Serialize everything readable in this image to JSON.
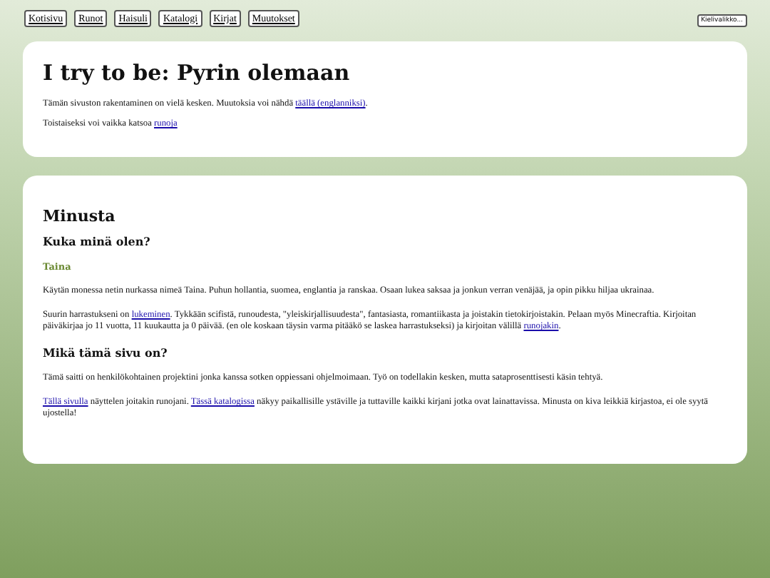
{
  "nav": {
    "links": [
      "Kotisivu",
      "Runot",
      "Haisuli",
      "Katalogi",
      "Kirjat",
      "Muutokset"
    ],
    "language_button": "Kielivalikko..."
  },
  "intro": {
    "title": "I try to be: Pyrin olemaan",
    "paragraphs": [
      [
        {
          "kind": "text",
          "text": "Tämän sivuston rakentaminen on vielä kesken. Muutoksia voi nähdä "
        },
        {
          "kind": "link",
          "text": "täällä (englanniksi)"
        },
        {
          "kind": "text",
          "text": "."
        }
      ],
      [
        {
          "kind": "text",
          "text": "Toistaiseksi voi vaikka katsoa "
        },
        {
          "kind": "link",
          "text": "runoja"
        }
      ]
    ]
  },
  "about": {
    "blocks": [
      {
        "kind": "heading",
        "text": "Minusta"
      },
      {
        "kind": "subheading",
        "text": "Kuka minä olen?"
      },
      {
        "kind": "name",
        "text": "Taina"
      },
      {
        "kind": "paragraph",
        "parts": [
          {
            "kind": "text",
            "text": "Käytän monessa netin nurkassa nimeä Taina. Puhun hollantia, suomea, englantia ja ranskaa. Osaan lukea saksaa ja jonkun verran venäjää, ja opin pikku hiljaa ukrainaa."
          }
        ]
      },
      {
        "kind": "paragraph",
        "parts": [
          {
            "kind": "text",
            "text": "Suurin harrastukseni on "
          },
          {
            "kind": "link",
            "text": "lukeminen"
          },
          {
            "kind": "text",
            "text": ". Tykkään scifistä, runoudesta, \"yleiskirjallisuudesta\", fantasiasta, romantiikasta ja joistakin tietokirjoistakin. Pelaan myös Minecraftia. Kirjoitan päiväkirjaa jo 11 vuotta, 11 kuukautta ja 0 päivää. (en ole koskaan täysin varma pitääkö se laskea harrastukseksi) ja kirjoitan välillä "
          },
          {
            "kind": "link",
            "text": "runojakin"
          },
          {
            "kind": "text",
            "text": "."
          }
        ]
      },
      {
        "kind": "subheading",
        "text": "Mikä tämä sivu on?"
      },
      {
        "kind": "paragraph",
        "parts": [
          {
            "kind": "text",
            "text": "Tämä saitti on henkilökohtainen projektini jonka kanssa sotken oppiessani ohjelmoimaan. Työ on todellakin kesken, mutta sataprosenttisesti käsin tehtyä."
          }
        ]
      },
      {
        "kind": "paragraph",
        "parts": [
          {
            "kind": "link",
            "text": "Tällä sivulla"
          },
          {
            "kind": "text",
            "text": " näyttelen joitakin runojani. "
          },
          {
            "kind": "link",
            "text": "Tässä katalogissa"
          },
          {
            "kind": "text",
            "text": " näkyy paikallisille ystäville ja tuttaville kaikki kirjani jotka ovat lainattavissa. Minusta on kiva leikkiä kirjastoa, ei ole syytä ujostella!"
          }
        ]
      }
    ]
  }
}
